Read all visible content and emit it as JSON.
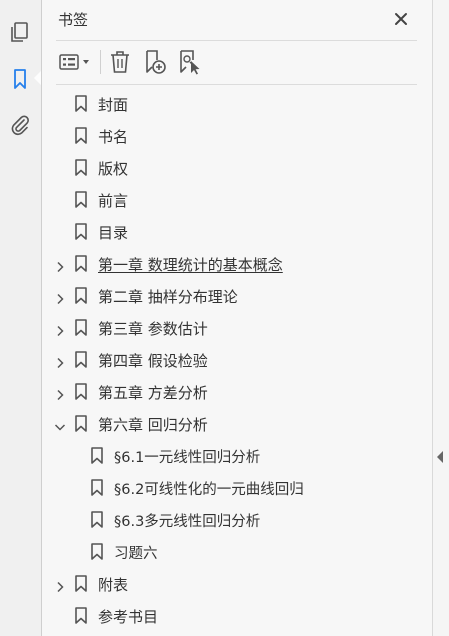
{
  "panel": {
    "title": "书签"
  },
  "colors": {
    "accent": "#2680eb",
    "icon": "#555555",
    "text": "#333333"
  },
  "bookmarks": [
    {
      "label": "封面",
      "level": 0,
      "expander": "none"
    },
    {
      "label": "书名",
      "level": 0,
      "expander": "none"
    },
    {
      "label": "版权",
      "level": 0,
      "expander": "none"
    },
    {
      "label": "前言",
      "level": 0,
      "expander": "none"
    },
    {
      "label": "目录",
      "level": 0,
      "expander": "none"
    },
    {
      "label": "第一章  数理统计的基本概念",
      "level": 0,
      "expander": "collapsed",
      "underlined": true
    },
    {
      "label": "第二章  抽样分布理论",
      "level": 0,
      "expander": "collapsed"
    },
    {
      "label": "第三章  参数估计",
      "level": 0,
      "expander": "collapsed"
    },
    {
      "label": "第四章  假设检验",
      "level": 0,
      "expander": "collapsed"
    },
    {
      "label": "第五章  方差分析",
      "level": 0,
      "expander": "collapsed"
    },
    {
      "label": "第六章  回归分析",
      "level": 0,
      "expander": "expanded"
    },
    {
      "label": "§6.1一元线性回归分析",
      "level": 1,
      "expander": "none"
    },
    {
      "label": "§6.2可线性化的一元曲线回归",
      "level": 1,
      "expander": "none"
    },
    {
      "label": "§6.3多元线性回归分析",
      "level": 1,
      "expander": "none"
    },
    {
      "label": "习题六",
      "level": 1,
      "expander": "none"
    },
    {
      "label": "附表",
      "level": 0,
      "expander": "collapsed"
    },
    {
      "label": "参考书目",
      "level": 0,
      "expander": "none"
    }
  ]
}
